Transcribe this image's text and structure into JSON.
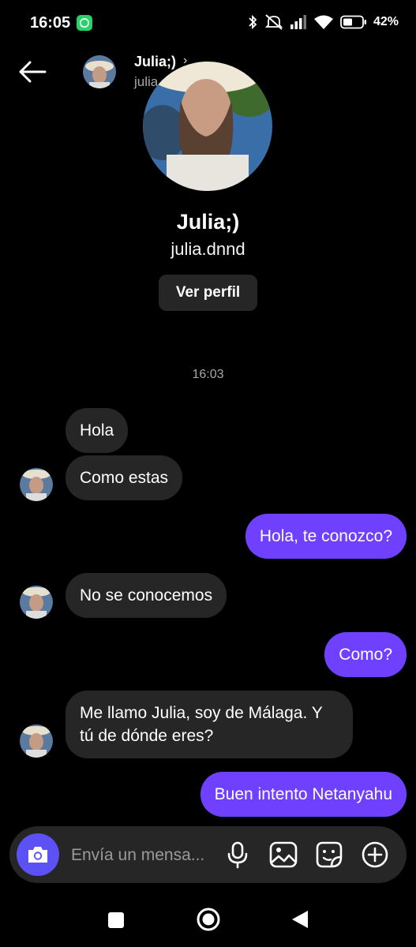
{
  "status_bar": {
    "time": "16:05",
    "battery": "42%"
  },
  "header": {
    "name": "Julia;)",
    "chevron": "›",
    "username": "julia.dnnd"
  },
  "profile": {
    "name": "Julia;)",
    "username": "julia.dnnd",
    "view_profile_label": "Ver perfil"
  },
  "timestamp": "16:03",
  "messages": [
    {
      "from": "them",
      "text": "Hola"
    },
    {
      "from": "them",
      "text": "Como estas"
    },
    {
      "from": "me",
      "text": "Hola, te conozco?"
    },
    {
      "from": "them",
      "text": "No se conocemos"
    },
    {
      "from": "me",
      "text": "Como?"
    },
    {
      "from": "them",
      "text": "Me llamo Julia, soy de Málaga. Y tú de dónde eres?"
    },
    {
      "from": "me",
      "text": "Buen intento Netanyahu"
    }
  ],
  "composer": {
    "placeholder": "Envía un mensa..."
  },
  "icons": [
    "whatsapp-icon",
    "bluetooth-icon",
    "mute-icon",
    "signal-icon",
    "wifi-icon",
    "battery-icon",
    "back-arrow-icon",
    "camera-icon",
    "microphone-icon",
    "gallery-icon",
    "sticker-icon",
    "add-icon"
  ],
  "colors": {
    "outgoing_bubble": "#7040ff",
    "incoming_bubble": "#262626",
    "camera_button": "#5b51f4",
    "background": "#000000"
  }
}
